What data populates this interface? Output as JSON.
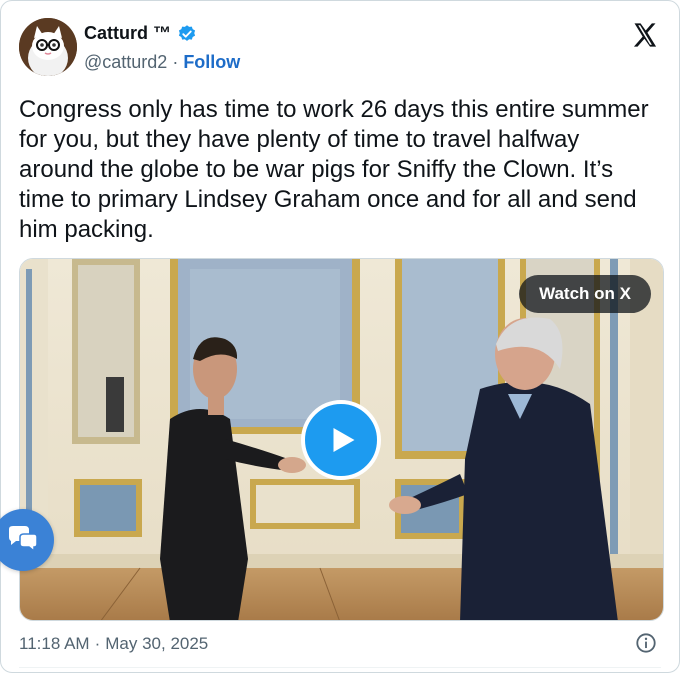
{
  "author": {
    "display_name": "Catturd ™",
    "handle": "@catturd2",
    "separator": "·",
    "follow_label": "Follow"
  },
  "tweet": {
    "text": "Congress only has time to work 26 days this entire summer for you, but they have plenty of time to travel halfway around the globe to be war pigs for Sniffy the Clown. It’s time to primary Lindsey Graham once and for all and send him packing."
  },
  "media": {
    "watch_label": "Watch on X"
  },
  "footer": {
    "time": "11:18 AM",
    "separator": "·",
    "date": "May 30, 2025"
  },
  "colors": {
    "accent": "#1d9bf0",
    "follow": "#1d6cc8",
    "verified": "#1d9bf0",
    "muted": "#536471"
  },
  "icons": {
    "logo": "x-logo-icon",
    "verified": "verified-badge-icon",
    "play": "play-icon",
    "info": "info-icon",
    "chat": "chat-bubbles-icon"
  }
}
